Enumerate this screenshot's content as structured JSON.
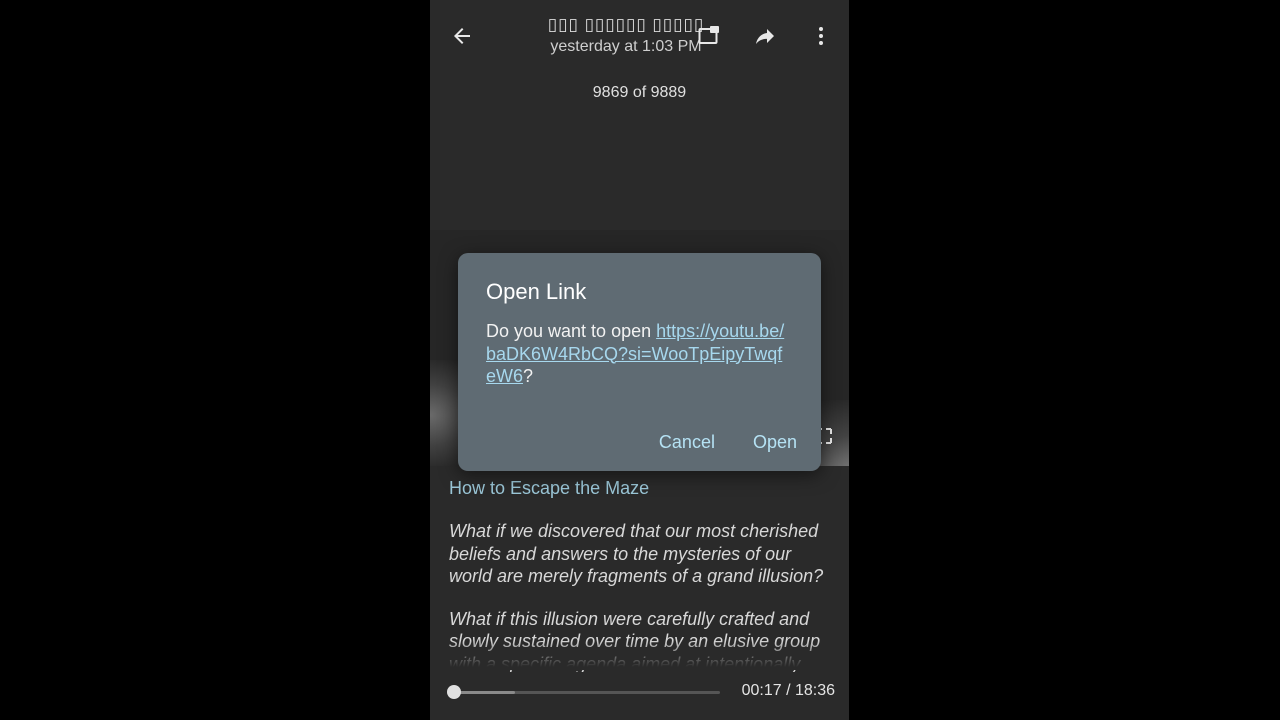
{
  "header": {
    "title": "▯▯▯ ▯▯▯▯▯▯ ▯▯▯▯▯",
    "subtitle": "yesterday at 1:03 PM",
    "counter": "9869 of 9889"
  },
  "icons": {
    "back": "arrow-left-icon",
    "pip": "picture-in-picture-icon",
    "share": "share-forward-icon",
    "more": "more-vertical-icon",
    "fullscreen": "fullscreen-icon"
  },
  "dialog": {
    "title": "Open Link",
    "prompt": "Do you want to open ",
    "url": "https://youtu.be/baDK6W4RbCQ?si=WooTpEipyTwqfeW6",
    "suffix": "?",
    "cancel_label": "Cancel",
    "open_label": "Open"
  },
  "article": {
    "title": "How to Escape the Maze",
    "paragraphs": [
      "What if we discovered that our most cherished beliefs and answers to the mysteries of our world are merely fragments of a grand illusion?",
      "What if this illusion were carefully crafted and slowly sustained over time by an elusive group with a specific agenda aimed at intentionally"
    ]
  },
  "player": {
    "current_time": "00:17",
    "separator": " / ",
    "duration": "18:36",
    "time_text": "00:17 / 18:36",
    "progress_fraction": 0.015,
    "buffered_fraction": 0.24
  },
  "colors": {
    "dialog_bg": "#5f6b73",
    "link": "#a7d8ee",
    "accent": "#b5e2f4",
    "article_title": "#9bc7d8"
  }
}
